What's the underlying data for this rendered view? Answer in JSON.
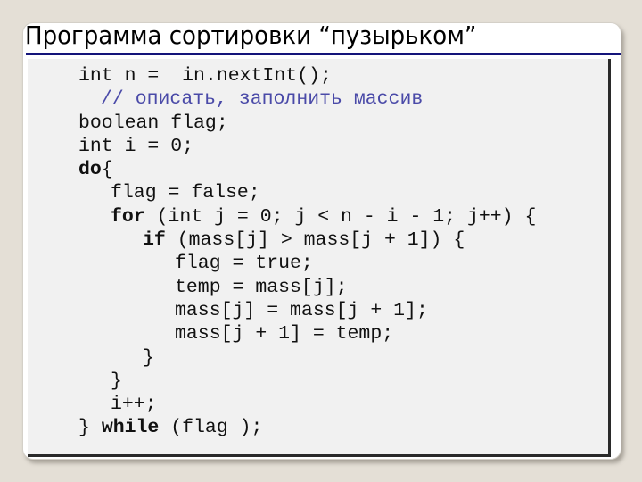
{
  "slide": {
    "title": "Программа сортировки “пузырьком”",
    "colors": {
      "background": "#e4dfd6",
      "title_rule": "#14147a",
      "code_background": "#f1f1f1",
      "comment": "#4a4aa8",
      "code_text": "#111111"
    }
  },
  "code": {
    "language": "Java",
    "lines": [
      {
        "indent": 0,
        "parts": [
          {
            "t": "int n =  in.nextInt();",
            "k": "plain"
          }
        ]
      },
      {
        "indent": "c",
        "parts": [
          {
            "t": "// описать, заполнить массив",
            "k": "comment"
          }
        ]
      },
      {
        "indent": 0,
        "parts": [
          {
            "t": "boolean flag;",
            "k": "plain"
          }
        ]
      },
      {
        "indent": 0,
        "parts": [
          {
            "t": "int i = 0;",
            "k": "plain"
          }
        ]
      },
      {
        "indent": 0,
        "parts": [
          {
            "t": "do",
            "k": "kw"
          },
          {
            "t": "{",
            "k": "plain"
          }
        ]
      },
      {
        "indent": 1,
        "parts": [
          {
            "t": "flag = false;",
            "k": "plain"
          }
        ]
      },
      {
        "indent": 1,
        "parts": [
          {
            "t": "for",
            "k": "kw"
          },
          {
            "t": " (int j = 0; j < n - i - 1; j++) {",
            "k": "plain"
          }
        ]
      },
      {
        "indent": 2,
        "parts": [
          {
            "t": "if",
            "k": "kw"
          },
          {
            "t": " (mass[j] > mass[j + 1]) {",
            "k": "plain"
          }
        ]
      },
      {
        "indent": 3,
        "parts": [
          {
            "t": "flag = true;",
            "k": "plain"
          }
        ]
      },
      {
        "indent": 3,
        "parts": [
          {
            "t": "temp = mass[j];",
            "k": "plain"
          }
        ]
      },
      {
        "indent": 3,
        "parts": [
          {
            "t": "mass[j] = mass[j + 1];",
            "k": "plain"
          }
        ]
      },
      {
        "indent": 3,
        "parts": [
          {
            "t": "mass[j + 1] = temp;",
            "k": "plain"
          }
        ]
      },
      {
        "indent": 2,
        "parts": [
          {
            "t": "}",
            "k": "plain"
          }
        ]
      },
      {
        "indent": 1,
        "parts": [
          {
            "t": "}",
            "k": "plain"
          }
        ]
      },
      {
        "indent": 1,
        "parts": [
          {
            "t": "i++;",
            "k": "plain"
          }
        ]
      },
      {
        "indent": 0,
        "parts": [
          {
            "t": "} ",
            "k": "plain"
          },
          {
            "t": "while",
            "k": "kw"
          },
          {
            "t": " (flag );",
            "k": "plain"
          }
        ]
      }
    ]
  }
}
